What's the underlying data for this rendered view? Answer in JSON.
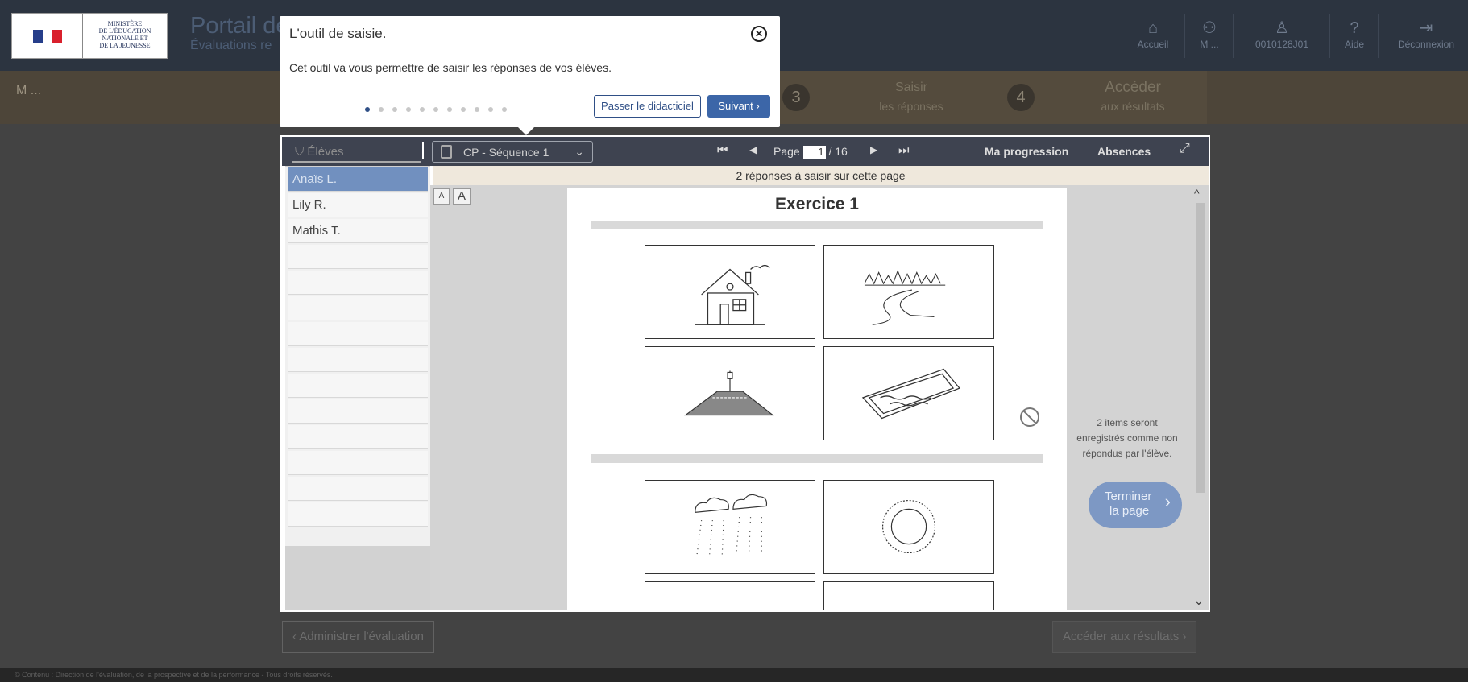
{
  "header": {
    "ministry_lines": [
      "MINISTÈRE",
      "DE L'ÉDUCATION",
      "NATIONALE ET",
      "DE LA JEUNESSE"
    ],
    "portal_title": "Portail de",
    "portal_subtitle": "Évaluations re",
    "nav": [
      {
        "label": "Accueil",
        "icon": "home-icon",
        "glyph": "⌂"
      },
      {
        "label": "M ...",
        "icon": "users-icon",
        "glyph": "⚇"
      },
      {
        "label": "0010128J01",
        "icon": "user-icon",
        "glyph": "♙"
      },
      {
        "label": "Aide",
        "icon": "help-icon",
        "glyph": "?"
      },
      {
        "label": "Déconnexion",
        "icon": "logout-icon",
        "glyph": "⇥"
      }
    ]
  },
  "stepbar": {
    "user": "M ...",
    "steps": [
      {
        "num": "3",
        "line1": "Saisir",
        "line2": "les réponses"
      },
      {
        "num": "4",
        "line1": "Accéder",
        "line2": "aux résultats"
      }
    ]
  },
  "tutorial": {
    "title": "L'outil de saisie.",
    "body": "Cet outil va vous permettre de saisir les réponses de vos élèves.",
    "dots_total": 11,
    "dot_active": 1,
    "skip_label": "Passer le didacticiel",
    "next_label": "Suivant ›"
  },
  "tool": {
    "students_label": "Élèves",
    "sequence_label": "CP - Séquence 1",
    "page_label": "Page",
    "page_current": "1",
    "page_total": "/ 16",
    "progress_label": "Ma progression",
    "absences_label": "Absences",
    "notice": "2 réponses à saisir sur cette page",
    "font_small": "A",
    "font_large": "A"
  },
  "students": [
    "Anaïs L.",
    "Lily R.",
    "Mathis T."
  ],
  "exercise": {
    "title": "Exercice 1",
    "images_top": [
      "house",
      "forest-road",
      "crossing-road",
      "pool"
    ],
    "images_bottom": [
      "snow-clouds",
      "sun"
    ]
  },
  "side": {
    "info": "2 items seront enregistrés comme non répondus par l'élève.",
    "finish_line1": "Terminer",
    "finish_line2": "la page"
  },
  "bottom": {
    "back_label": "‹  Administrer l'évaluation",
    "results_label": "Accéder aux résultats  ›"
  },
  "footer": "© Contenu : Direction de l'évaluation, de la prospective et de la performance - Tous droits réservés."
}
